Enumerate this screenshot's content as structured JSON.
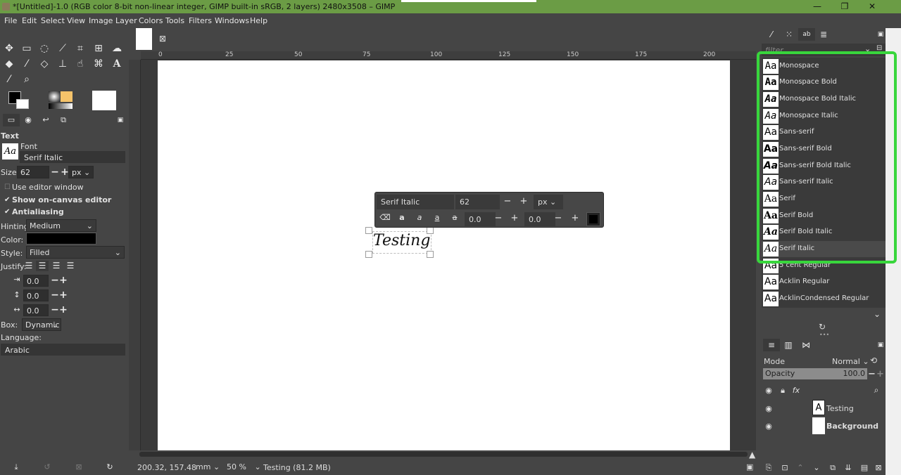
{
  "window": {
    "title": "*[Untitled]-1.0 (RGB color 8-bit non-linear integer, GIMP built-in sRGB, 2 layers) 2480x3508 – GIMP",
    "minimize": "—",
    "maximize": "❐",
    "close": "✕"
  },
  "menu": [
    "File",
    "Edit",
    "Select",
    "View",
    "Image",
    "Layer",
    "Colors",
    "Tools",
    "Filters",
    "Windows",
    "Help"
  ],
  "tool_options": {
    "section": "Text",
    "font_label": "Font",
    "font_value": "Serif Italic",
    "font_preview": "Aa",
    "size_label": "Size:",
    "size_value": "62",
    "size_unit": "px",
    "use_editor": "Use editor window",
    "show_editor": "Show on-canvas editor",
    "antialiasing": "Antialiasing",
    "hinting_label": "Hinting:",
    "hinting_value": "Medium",
    "color_label": "Color:",
    "color_value": "#000000",
    "style_label": "Style:",
    "style_value": "Filled",
    "justify_label": "Justify:",
    "indent_value": "0.0",
    "line_spacing_value": "0.0",
    "letter_spacing_value": "0.0",
    "box_label": "Box:",
    "box_value": "Dynamic",
    "language_label": "Language:",
    "language_value": "Arabic"
  },
  "ruler": {
    "ticks": [
      "0",
      "25",
      "50",
      "75",
      "100",
      "125",
      "150",
      "175",
      "200"
    ]
  },
  "on_canvas_editor": {
    "font": "Serif Italic",
    "size": "62",
    "unit": "px",
    "baseline": "0.0",
    "kerning": "0.0"
  },
  "canvas_text": "Testing",
  "status": {
    "coords": "200.32, 157.48",
    "unit": "mm",
    "zoom": "50 %",
    "info": "Testing (81.2 MB)"
  },
  "fonts_panel": {
    "filter_placeholder": "filter",
    "preview": "Aa",
    "fonts": [
      "Monospace",
      "Monospace Bold",
      "Monospace Bold Italic",
      "Monospace Italic",
      "Sans-serif",
      "Sans-serif Bold",
      "Sans-serif Bold Italic",
      "Sans-serif Italic",
      "Serif",
      "Serif Bold",
      "Serif Bold Italic",
      "Serif Italic",
      "5 cent Regular",
      "Acklin Regular",
      "AcklinCondensed Regular"
    ],
    "selected": "Serif Italic",
    "highlight_color": "#38d63c"
  },
  "layers_panel": {
    "mode_label": "Mode",
    "mode_value": "Normal",
    "opacity_label": "Opacity",
    "opacity_value": "100.0",
    "layers": [
      {
        "name": "Testing",
        "type": "text"
      },
      {
        "name": "Background",
        "type": "image"
      }
    ]
  }
}
